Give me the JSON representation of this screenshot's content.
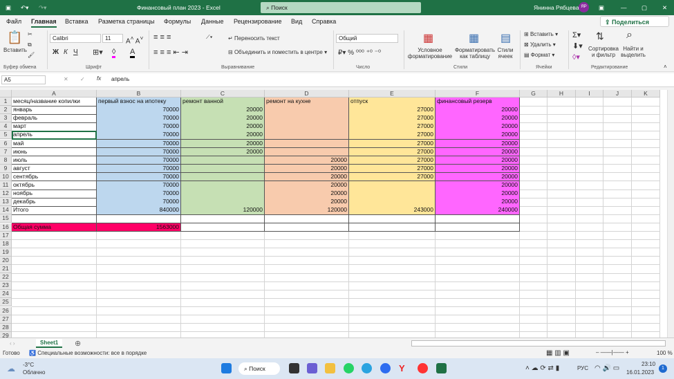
{
  "title": {
    "doc": "Финансовый план 2023  -  Excel",
    "search": "Поиск",
    "user": "Янинна Рябцева",
    "initials": "ЯР"
  },
  "menu": [
    "Файл",
    "Главная",
    "Вставка",
    "Разметка страницы",
    "Формулы",
    "Данные",
    "Рецензирование",
    "Вид",
    "Справка"
  ],
  "share": "Поделиться",
  "ribbon": {
    "paste": "Вставить",
    "font": "Calibri",
    "size": "11",
    "bold": "Ж",
    "italic": "К",
    "underline": "Ч",
    "wrap": "Переносить текст",
    "merge": "Объединить и поместить в центре",
    "numfmt": "Общий",
    "cond": "Условное форматирование",
    "fmt_table": "Форматировать как таблицу",
    "styles": "Стили ячеек",
    "insert": "Вставить",
    "delete": "Удалить",
    "format": "Формат",
    "sort": "Сортировка и фильтр",
    "find": "Найти и выделить",
    "groups": [
      "Буфер обмена",
      "Шрифт",
      "Выравнивание",
      "Число",
      "Стили",
      "Ячейки",
      "Редактирование"
    ]
  },
  "formula": {
    "namebox": "A5",
    "fx": "fx",
    "value": "апрель"
  },
  "grid": {
    "columns": [
      "A",
      "B",
      "C",
      "D",
      "E",
      "F",
      "G",
      "H",
      "I",
      "J",
      "K"
    ],
    "fills": {
      "B": "#bdd7ee",
      "C": "#c6e0b4",
      "D": "#f8cbad",
      "E": "#ffe699",
      "F": "#ff66ff",
      "total": "#ff0066"
    },
    "rows": [
      [
        "месяц/название копилки",
        "первый взнос на ипотеку",
        "ремонт ванной",
        "ремонт на кухне",
        "отпуск",
        "финансовый резерв"
      ],
      [
        "январь",
        "70000",
        "20000",
        "",
        "27000",
        "20000"
      ],
      [
        "февраль",
        "70000",
        "20000",
        "",
        "27000",
        "20000"
      ],
      [
        "март",
        "70000",
        "20000",
        "",
        "27000",
        "20000"
      ],
      [
        "апрель",
        "70000",
        "20000",
        "",
        "27000",
        "20000"
      ],
      [
        "май",
        "70000",
        "20000",
        "",
        "27000",
        "20000"
      ],
      [
        "июнь",
        "70000",
        "20000",
        "",
        "27000",
        "20000"
      ],
      [
        "июль",
        "70000",
        "",
        "20000",
        "27000",
        "20000"
      ],
      [
        "август",
        "70000",
        "",
        "20000",
        "27000",
        "20000"
      ],
      [
        "сентябрь",
        "70000",
        "",
        "20000",
        "27000",
        "20000"
      ],
      [
        "октябрь",
        "70000",
        "",
        "20000",
        "",
        "20000"
      ],
      [
        "ноябрь",
        "70000",
        "",
        "20000",
        "",
        "20000"
      ],
      [
        "декабрь",
        "70000",
        "",
        "20000",
        "",
        "20000"
      ],
      [
        "Итого",
        "840000",
        "120000",
        "120000",
        "243000",
        "240000"
      ],
      [
        "",
        "",
        "",
        "",
        "",
        ""
      ],
      [
        "Общая сумма",
        "1563000",
        "",
        "",
        "",
        ""
      ]
    ],
    "selected": "A5"
  },
  "sheet": "Sheet1",
  "status": {
    "ready": "Готово",
    "access": "Специальные возможности: все в порядке",
    "zoom": "100 %"
  },
  "taskbar": {
    "temp": "-3°C",
    "weather": "Облачно",
    "search": "Поиск",
    "lang": "РУС",
    "time": "23:10",
    "date": "16.01.2023",
    "badge": "1"
  }
}
